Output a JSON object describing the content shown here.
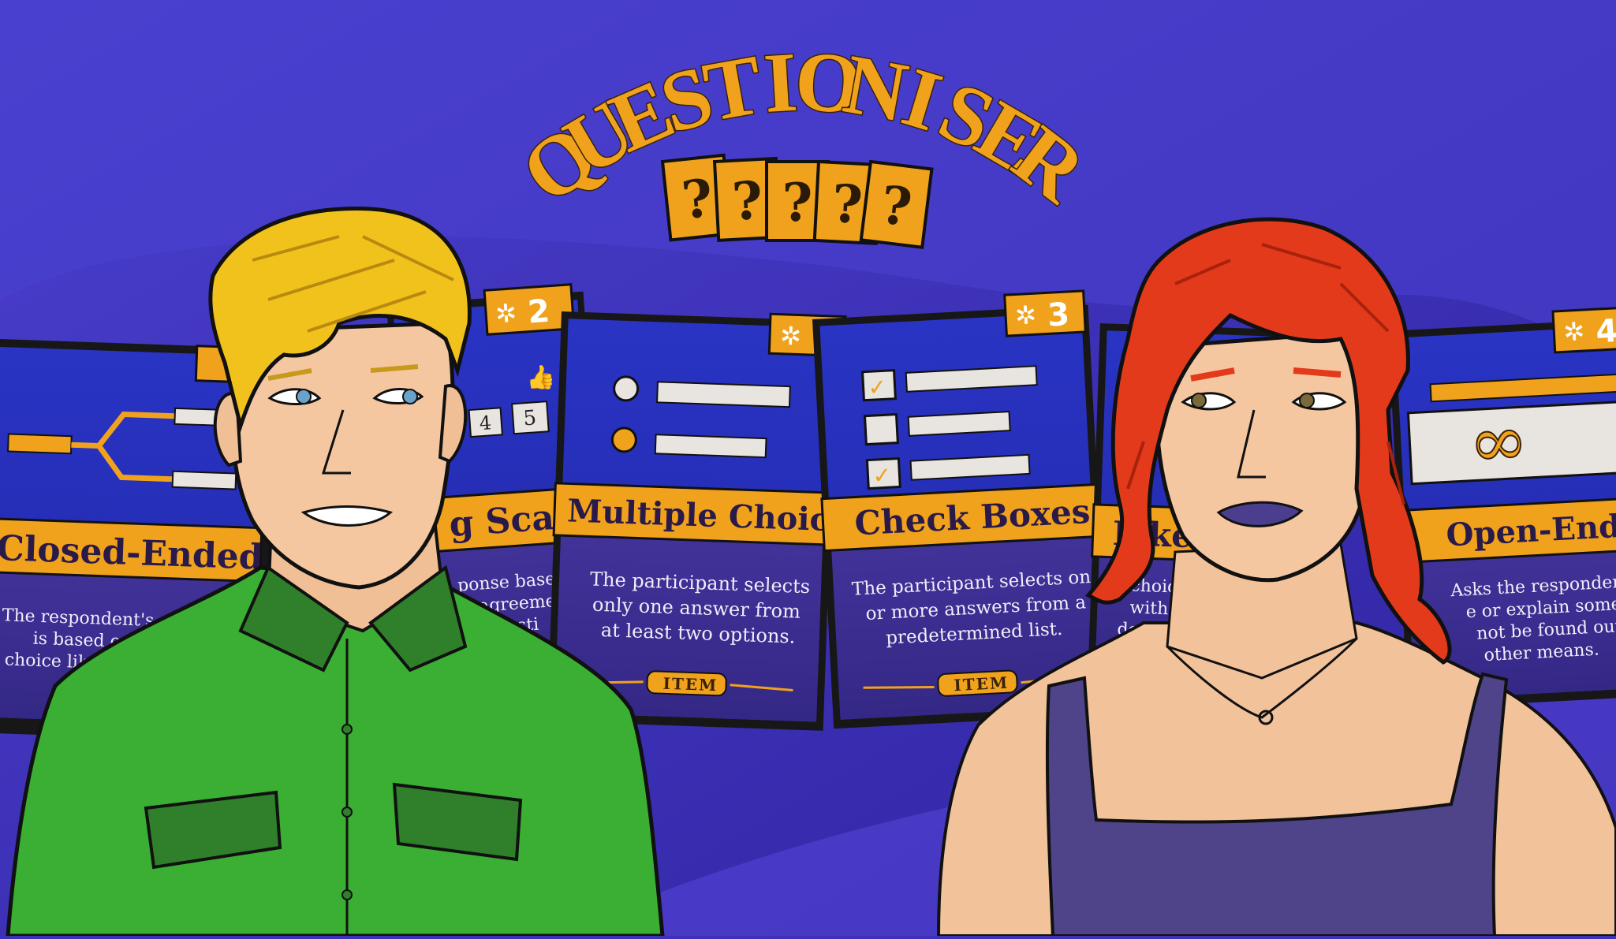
{
  "title": "QUESTIONISER",
  "question_cards": [
    "?",
    "?",
    "?",
    "?",
    "?"
  ],
  "cards": [
    {
      "name": "closed-ended",
      "title": "Closed-Ended",
      "badge": "",
      "lines": [
        "The respondent's answ",
        "is based on a li",
        "choice lik"
      ],
      "item_label": ""
    },
    {
      "name": "rating-scale",
      "title": "g Scale",
      "badge": "2",
      "lines": [
        "ponse based",
        "f agreeme",
        "uesti"
      ],
      "scale_values": [
        "4",
        "5"
      ],
      "item_label": ""
    },
    {
      "name": "multiple-choice",
      "title": "Multiple Choice",
      "badge": "",
      "lines": [
        "The participant selects",
        "only one answer from",
        "at least two options."
      ],
      "item_label": "ITEM"
    },
    {
      "name": "check-boxes",
      "title": "Check Boxes",
      "badge": "3",
      "lines": [
        "The participant selects one",
        "or more answers from a",
        "predetermined list."
      ],
      "item_label": "ITEM"
    },
    {
      "name": "likert",
      "title": "Like",
      "badge": "",
      "lines": [
        "choic",
        "with",
        "descri"
      ],
      "item_label": ""
    },
    {
      "name": "open-ended",
      "title": "Open-Ended",
      "badge": "4",
      "lines": [
        "Asks the respondent to",
        "e or explain somethi",
        "not be found out us",
        "other means."
      ],
      "item_label": ""
    }
  ],
  "colors": {
    "background": "#3f32b8",
    "card_blue": "#2b2fb0",
    "card_purple": "#3d2e9a",
    "accent_orange": "#f0a21c",
    "outline": "#111111"
  },
  "characters": [
    {
      "name": "blond-man",
      "hair": "#f2c21c",
      "shirt": "#38ad32"
    },
    {
      "name": "red-haired-woman",
      "hair": "#e23a1a",
      "top": "#4f4389"
    }
  ],
  "icons": [
    "gear-icon",
    "thumbs-up-icon",
    "radio-icon",
    "checkbox-icon",
    "infinity-icon",
    "branch-icon"
  ]
}
